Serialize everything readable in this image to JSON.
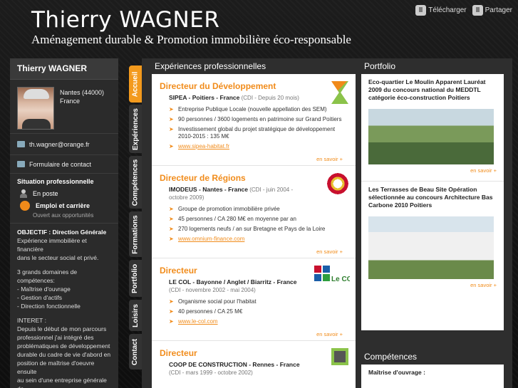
{
  "header": {
    "name": "Thierry WAGNER",
    "subtitle": "Aménagement durable & Promotion immobilière éco-responsable",
    "actions": [
      {
        "label": "Télécharger",
        "icon": "download-icon"
      },
      {
        "label": "Partager",
        "icon": "share-icon"
      }
    ]
  },
  "sidebar": {
    "title": "Thierry WAGNER",
    "location": [
      "Nantes (44000)",
      "France"
    ],
    "email": "th.wagner@orange.fr",
    "contact": "Formulaire de contact",
    "situation_heading": "Situation professionnelle",
    "status": "En poste",
    "jobs_label": "Emploi et carrière",
    "jobs_sub": "Ouvert aux opportunités",
    "objectif_label": "OBJECTIF : Direction Générale",
    "objectif_lines": [
      "Expérience immobilière et financière",
      "dans le secteur social et privé.",
      "",
      "3 grands domaines de",
      "compétences:",
      "- Maîtrise d'ouvrage",
      "- Gestion d'actifs",
      "- Direction fonctionnelle",
      "",
      "INTERET :",
      "Depuis le début de mon parcours",
      "professionnel j'ai intégré des",
      "problématiques de développement",
      "durable du cadre de vie d'abord en",
      "position de maîtrise d'oeuvre ensuite",
      "au sein d'une entreprise générale de"
    ]
  },
  "tabs": [
    "Accueil",
    "Expériences",
    "Compétences",
    "Formations",
    "Portfolio",
    "Loisirs",
    "Contact"
  ],
  "main": {
    "experiences_heading": "Expériences professionnelles",
    "portfolio_heading": "Portfolio",
    "competences_heading": "Compétences",
    "more_label": "en savoir +",
    "experiences": [
      {
        "title": "Directeur du Développement",
        "company": "SIPEA - Poitiers - France",
        "meta": "(CDI - Depuis 20 mois)",
        "bullets": [
          "Entreprise Publique Locale (nouvelle appellation des SEM)",
          "90 personnes / 3600 logements en patrimoine sur Grand Poitiers",
          "Investissement global du projet stratégique de développement 2010-2015 : 135 M€"
        ],
        "link": "www.sipea-habitat.fr",
        "logo": "sipea-logo"
      },
      {
        "title": "Directeur de Régions",
        "company": "IMODEUS - Nantes - France",
        "meta": "(CDI - juin 2004 - octobre 2009)",
        "bullets": [
          "Groupe de promotion immobilière privée",
          "45 personnes / CA 280 M€ en moyenne par an",
          "270 logements neufs / an sur Bretagne et Pays de la Loire"
        ],
        "link": "www.omnium-finance.com",
        "logo": "imodeus-logo"
      },
      {
        "title": "Directeur",
        "company": "LE COL - Bayonne / Anglet / Biarritz - France",
        "meta": "(CDI - novembre 2002 - mai 2004)",
        "bullets": [
          "Organisme social pour l'habitat",
          "40 personnes / CA 25 M€"
        ],
        "link": "www.le-col.com",
        "logo": "lecol-logo",
        "logo_text": "Le COL"
      },
      {
        "title": "Directeur",
        "company": "COOP DE CONSTRUCTION - Rennes - France",
        "meta": "(CDI - mars 1999 - octobre 2002)",
        "bullets": [],
        "link": "",
        "logo": "coop-logo"
      }
    ],
    "portfolio": [
      {
        "title": "Eco-quartier Le Moulin Apparent Lauréat 2009 du concours national du MEDDTL catégorie éco-construction Poitiers"
      },
      {
        "title": "Les Terrasses de Beau Site Opération sélectionnée au concours Architecture Bas Carbone 2010 Poitiers"
      }
    ],
    "competences_first": "Maîtrise d'ouvrage :"
  },
  "colors": {
    "accent": "#f18c1b",
    "dark": "#2e2e2e"
  }
}
